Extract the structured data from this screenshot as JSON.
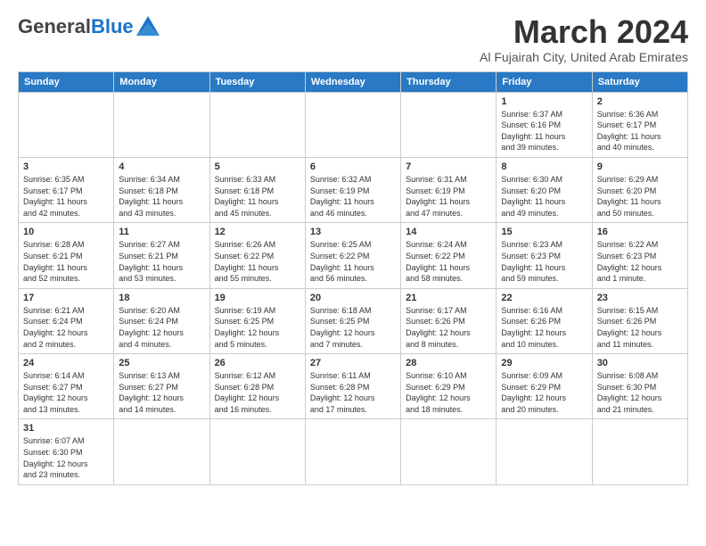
{
  "header": {
    "logo_general": "General",
    "logo_blue": "Blue",
    "month_year": "March 2024",
    "location": "Al Fujairah City, United Arab Emirates"
  },
  "weekdays": [
    "Sunday",
    "Monday",
    "Tuesday",
    "Wednesday",
    "Thursday",
    "Friday",
    "Saturday"
  ],
  "days": [
    {
      "date": "",
      "info": ""
    },
    {
      "date": "",
      "info": ""
    },
    {
      "date": "",
      "info": ""
    },
    {
      "date": "",
      "info": ""
    },
    {
      "date": "",
      "info": ""
    },
    {
      "date": "1",
      "info": "Sunrise: 6:37 AM\nSunset: 6:16 PM\nDaylight: 11 hours\nand 39 minutes."
    },
    {
      "date": "2",
      "info": "Sunrise: 6:36 AM\nSunset: 6:17 PM\nDaylight: 11 hours\nand 40 minutes."
    },
    {
      "date": "3",
      "info": "Sunrise: 6:35 AM\nSunset: 6:17 PM\nDaylight: 11 hours\nand 42 minutes."
    },
    {
      "date": "4",
      "info": "Sunrise: 6:34 AM\nSunset: 6:18 PM\nDaylight: 11 hours\nand 43 minutes."
    },
    {
      "date": "5",
      "info": "Sunrise: 6:33 AM\nSunset: 6:18 PM\nDaylight: 11 hours\nand 45 minutes."
    },
    {
      "date": "6",
      "info": "Sunrise: 6:32 AM\nSunset: 6:19 PM\nDaylight: 11 hours\nand 46 minutes."
    },
    {
      "date": "7",
      "info": "Sunrise: 6:31 AM\nSunset: 6:19 PM\nDaylight: 11 hours\nand 47 minutes."
    },
    {
      "date": "8",
      "info": "Sunrise: 6:30 AM\nSunset: 6:20 PM\nDaylight: 11 hours\nand 49 minutes."
    },
    {
      "date": "9",
      "info": "Sunrise: 6:29 AM\nSunset: 6:20 PM\nDaylight: 11 hours\nand 50 minutes."
    },
    {
      "date": "10",
      "info": "Sunrise: 6:28 AM\nSunset: 6:21 PM\nDaylight: 11 hours\nand 52 minutes."
    },
    {
      "date": "11",
      "info": "Sunrise: 6:27 AM\nSunset: 6:21 PM\nDaylight: 11 hours\nand 53 minutes."
    },
    {
      "date": "12",
      "info": "Sunrise: 6:26 AM\nSunset: 6:22 PM\nDaylight: 11 hours\nand 55 minutes."
    },
    {
      "date": "13",
      "info": "Sunrise: 6:25 AM\nSunset: 6:22 PM\nDaylight: 11 hours\nand 56 minutes."
    },
    {
      "date": "14",
      "info": "Sunrise: 6:24 AM\nSunset: 6:22 PM\nDaylight: 11 hours\nand 58 minutes."
    },
    {
      "date": "15",
      "info": "Sunrise: 6:23 AM\nSunset: 6:23 PM\nDaylight: 11 hours\nand 59 minutes."
    },
    {
      "date": "16",
      "info": "Sunrise: 6:22 AM\nSunset: 6:23 PM\nDaylight: 12 hours\nand 1 minute."
    },
    {
      "date": "17",
      "info": "Sunrise: 6:21 AM\nSunset: 6:24 PM\nDaylight: 12 hours\nand 2 minutes."
    },
    {
      "date": "18",
      "info": "Sunrise: 6:20 AM\nSunset: 6:24 PM\nDaylight: 12 hours\nand 4 minutes."
    },
    {
      "date": "19",
      "info": "Sunrise: 6:19 AM\nSunset: 6:25 PM\nDaylight: 12 hours\nand 5 minutes."
    },
    {
      "date": "20",
      "info": "Sunrise: 6:18 AM\nSunset: 6:25 PM\nDaylight: 12 hours\nand 7 minutes."
    },
    {
      "date": "21",
      "info": "Sunrise: 6:17 AM\nSunset: 6:26 PM\nDaylight: 12 hours\nand 8 minutes."
    },
    {
      "date": "22",
      "info": "Sunrise: 6:16 AM\nSunset: 6:26 PM\nDaylight: 12 hours\nand 10 minutes."
    },
    {
      "date": "23",
      "info": "Sunrise: 6:15 AM\nSunset: 6:26 PM\nDaylight: 12 hours\nand 11 minutes."
    },
    {
      "date": "24",
      "info": "Sunrise: 6:14 AM\nSunset: 6:27 PM\nDaylight: 12 hours\nand 13 minutes."
    },
    {
      "date": "25",
      "info": "Sunrise: 6:13 AM\nSunset: 6:27 PM\nDaylight: 12 hours\nand 14 minutes."
    },
    {
      "date": "26",
      "info": "Sunrise: 6:12 AM\nSunset: 6:28 PM\nDaylight: 12 hours\nand 16 minutes."
    },
    {
      "date": "27",
      "info": "Sunrise: 6:11 AM\nSunset: 6:28 PM\nDaylight: 12 hours\nand 17 minutes."
    },
    {
      "date": "28",
      "info": "Sunrise: 6:10 AM\nSunset: 6:29 PM\nDaylight: 12 hours\nand 18 minutes."
    },
    {
      "date": "29",
      "info": "Sunrise: 6:09 AM\nSunset: 6:29 PM\nDaylight: 12 hours\nand 20 minutes."
    },
    {
      "date": "30",
      "info": "Sunrise: 6:08 AM\nSunset: 6:30 PM\nDaylight: 12 hours\nand 21 minutes."
    },
    {
      "date": "31",
      "info": "Sunrise: 6:07 AM\nSunset: 6:30 PM\nDaylight: 12 hours\nand 23 minutes."
    }
  ]
}
